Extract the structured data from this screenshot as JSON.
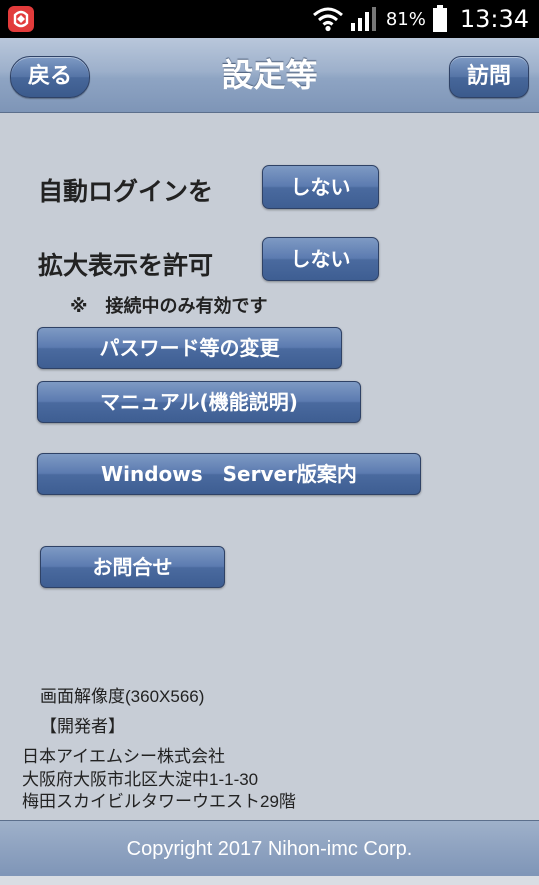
{
  "status_bar": {
    "battery_percent": "81%",
    "time": "13:34",
    "app_icon": "app-notification-icon",
    "wifi_icon": "wifi-icon",
    "signal_icon": "signal-icon",
    "battery_icon": "battery-icon"
  },
  "header": {
    "title": "設定等",
    "back_label": "戻る",
    "visit_label": "訪問"
  },
  "settings": {
    "auto_login": {
      "label": "自動ログインを",
      "value": "しない"
    },
    "zoom": {
      "label": "拡大表示を許可",
      "value": "しない"
    },
    "note": "※　接続中のみ有効です"
  },
  "buttons": {
    "password_change": "パスワード等の変更",
    "manual": "マニュアル(機能説明)",
    "windows_server": "Windows　Server版案内",
    "contact": "お問合せ"
  },
  "info": {
    "resolution": "画面解像度(360X566)",
    "developer_heading": "【開発者】",
    "company": "日本アイエムシー株式会社",
    "address1": "大阪府大阪市北区大淀中1-1-30",
    "address2": "梅田スカイビルタワーウエスト29階"
  },
  "footer": {
    "copyright": "Copyright 2017 Nihon-imc Corp."
  },
  "colors": {
    "background": "#c7cdd6",
    "button_blue": "#4a6a9f",
    "header": "#8ea4c3"
  }
}
